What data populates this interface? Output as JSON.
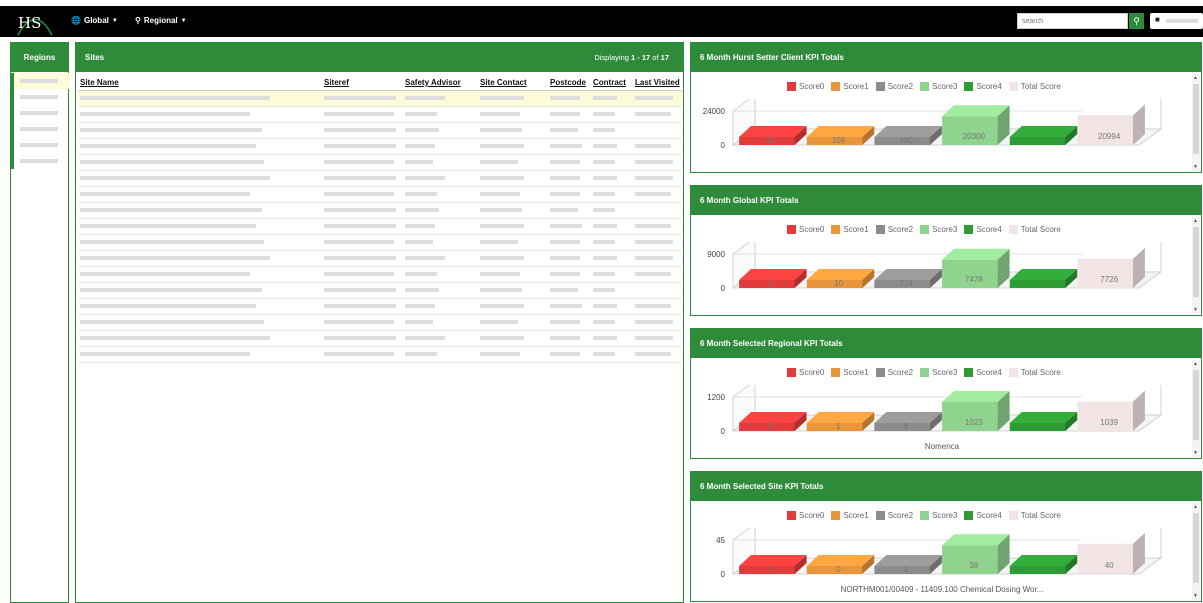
{
  "logo": {
    "text": "HS"
  },
  "nav": {
    "global": "Global",
    "regional": "Regional"
  },
  "search": {
    "placeholder": "search"
  },
  "regions": {
    "title": "Regions"
  },
  "sites": {
    "title": "Sites",
    "displaying_prefix": "Displaying",
    "range": "1 - 17",
    "of": "of",
    "total": "17",
    "columns": [
      "Site Name",
      "Siteref",
      "Safety Advisor",
      "Site Contact",
      "Postcode",
      "Contract",
      "Last Visited"
    ]
  },
  "legend": {
    "items": [
      {
        "label": "Score0",
        "color": "#e23b3b"
      },
      {
        "label": "Score1",
        "color": "#e8963c"
      },
      {
        "label": "Score2",
        "color": "#8c8c8c"
      },
      {
        "label": "Score3",
        "color": "#8fd38f"
      },
      {
        "label": "Score4",
        "color": "#2e9b35"
      },
      {
        "label": "Total Score",
        "color": "#f2e4e4"
      }
    ]
  },
  "chart_data": [
    {
      "type": "bar",
      "title": "6 Month Hurst Setter Client KPI Totals",
      "categories": [
        "Score0",
        "Score1",
        "Score2",
        "Score3",
        "Score4",
        "Total Score"
      ],
      "values": [
        95,
        109,
        490,
        20300,
        0,
        20994
      ],
      "value_labels": [
        "95",
        "109",
        "490",
        "20300",
        "",
        "20994"
      ],
      "yticks": [
        "24000",
        "0"
      ],
      "ylim": [
        0,
        24000
      ],
      "subtitle": ""
    },
    {
      "type": "bar",
      "title": "6 Month Global KPI Totals",
      "categories": [
        "Score0",
        "Score1",
        "Score2",
        "Score3",
        "Score4",
        "Total Score"
      ],
      "values": [
        1,
        10,
        214,
        7478,
        0,
        7726
      ],
      "value_labels": [
        "1",
        "10",
        "214",
        "7478",
        "",
        "7726"
      ],
      "yticks": [
        "9000",
        "0"
      ],
      "ylim": [
        0,
        9000
      ],
      "subtitle": ""
    },
    {
      "type": "bar",
      "title": "6 Month Selected Regional KPI Totals",
      "categories": [
        "Score0",
        "Score1",
        "Score2",
        "Score3",
        "Score4",
        "Total Score"
      ],
      "values": [
        0,
        1,
        8,
        1023,
        0,
        1039
      ],
      "value_labels": [
        "0",
        "1",
        "8",
        "1023",
        "",
        "1039"
      ],
      "yticks": [
        "1200",
        "0"
      ],
      "ylim": [
        0,
        1200
      ],
      "subtitle": "Nomenca"
    },
    {
      "type": "bar",
      "title": "6 Month Selected Site KPI Totals",
      "categories": [
        "Score0",
        "Score1",
        "Score2",
        "Score3",
        "Score4",
        "Total Score"
      ],
      "values": [
        0,
        0,
        2,
        38,
        0,
        40
      ],
      "value_labels": [
        "0",
        "0",
        "2",
        "38",
        "",
        "40"
      ],
      "yticks": [
        "45",
        "0"
      ],
      "ylim": [
        0,
        45
      ],
      "subtitle": "NORTHM001/00409 - 11409.100 Chemical Dosing Wor..."
    }
  ]
}
